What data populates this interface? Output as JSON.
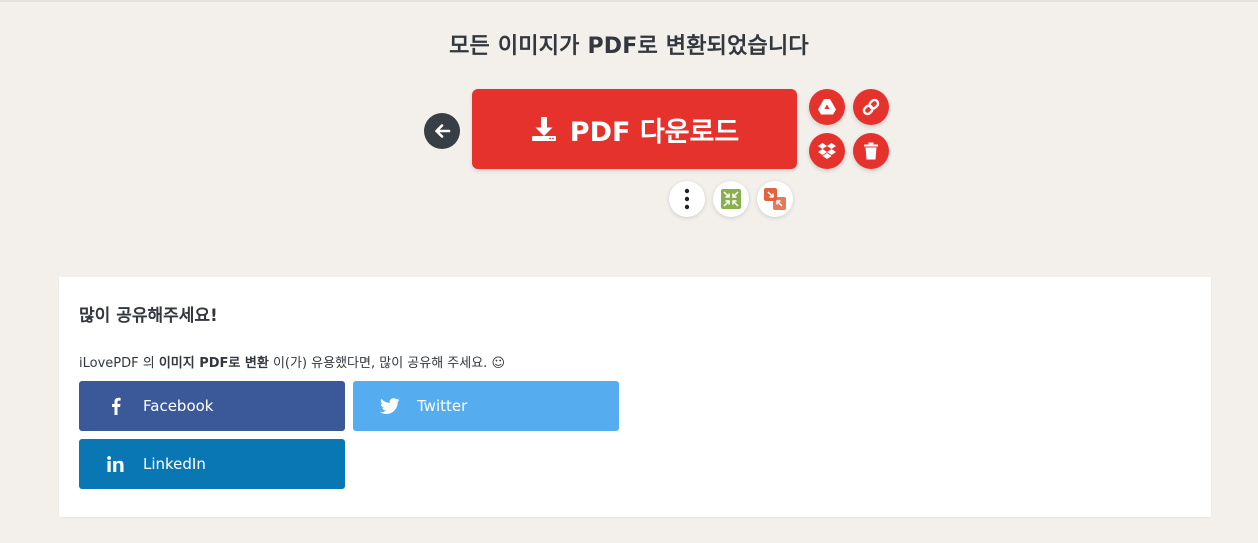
{
  "headline": "모든 이미지가 PDF로 변환되었습니다",
  "download_button": {
    "label": "PDF 다운로드"
  },
  "icons": {
    "back": "arrow-left-icon",
    "download": "download-icon",
    "google_drive": "google-drive-icon",
    "link": "link-icon",
    "dropbox": "dropbox-icon",
    "trash": "trash-icon",
    "more": "more-vertical-icon",
    "compress": "compress-pdf-icon",
    "split": "split-pdf-icon"
  },
  "share": {
    "title": "많이 공유해주세요!",
    "text_prefix": "iLovePDF 의 ",
    "text_bold": "이미지 PDF로 변환",
    "text_suffix": " 이(가) 유용했다면, 많이 공유해 주세요. ☺",
    "buttons": [
      {
        "label": "Facebook",
        "color": "#3b5998"
      },
      {
        "label": "Twitter",
        "color": "#55acee"
      },
      {
        "label": "LinkedIn",
        "color": "#0a77b5"
      }
    ]
  },
  "colors": {
    "accent": "#e5322d",
    "background": "#f3f0ec",
    "dark": "#383e45"
  }
}
